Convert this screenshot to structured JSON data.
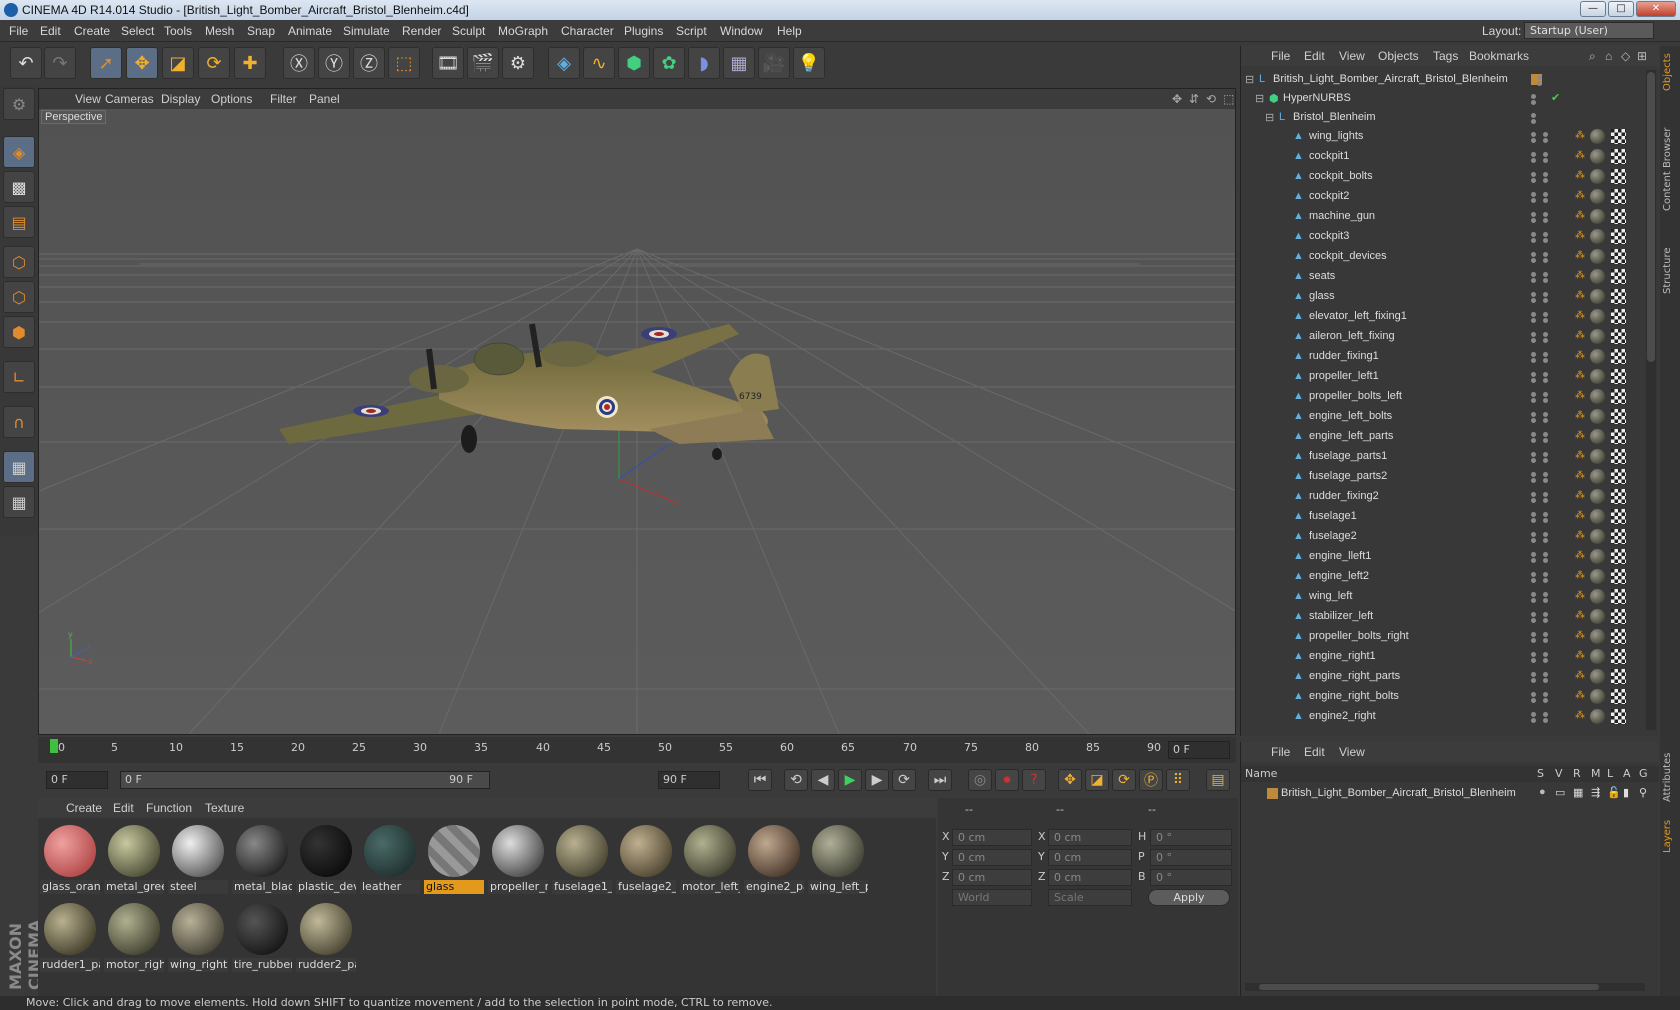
{
  "window": {
    "title": "CINEMA 4D R14.014 Studio - [British_Light_Bomber_Aircraft_Bristol_Blenheim.c4d]",
    "min": "—",
    "max": "□",
    "close": "✕"
  },
  "menu": [
    "File",
    "Edit",
    "Create",
    "Select",
    "Tools",
    "Mesh",
    "Snap",
    "Animate",
    "Simulate",
    "Render",
    "Sculpt",
    "MoGraph",
    "Character",
    "Plugins",
    "Script",
    "Window",
    "Help"
  ],
  "layout": {
    "label": "Layout:",
    "value": "Startup (User)"
  },
  "viewport": {
    "menu": [
      "View",
      "Cameras",
      "Display",
      "Options",
      "Filter",
      "Panel"
    ],
    "label": "Perspective"
  },
  "timeline": {
    "ticks": [
      "0",
      "5",
      "10",
      "15",
      "20",
      "25",
      "30",
      "35",
      "40",
      "45",
      "50",
      "55",
      "60",
      "65",
      "70",
      "75",
      "80",
      "85",
      "90"
    ],
    "current": "0 F"
  },
  "transport": {
    "start": "0 F",
    "range_start": "0 F",
    "range_end": "90 F",
    "end": "90 F"
  },
  "materials": {
    "menu": [
      "Create",
      "Edit",
      "Function",
      "Texture"
    ],
    "items": [
      "glass_oran",
      "metal_gree",
      "steel",
      "metal_blac",
      "plastic_dev",
      "leather",
      "glass",
      "propeller_r",
      "fuselage1_",
      "fuselage2_",
      "motor_left_",
      "engine2_pa",
      "wing_left_p",
      "rudder1_pa",
      "motor_righ",
      "wing_right",
      "tire_rubber",
      "rudder2_pa"
    ],
    "selected": "glass"
  },
  "coords": {
    "header": [
      "--",
      "--",
      "--"
    ],
    "rows": [
      [
        "X",
        "0 cm",
        "X",
        "0 cm",
        "H",
        "0 °"
      ],
      [
        "Y",
        "0 cm",
        "Y",
        "0 cm",
        "P",
        "0 °"
      ],
      [
        "Z",
        "0 cm",
        "Z",
        "0 cm",
        "B",
        "0 °"
      ]
    ],
    "world": "World",
    "scale": "Scale",
    "apply": "Apply"
  },
  "objects": {
    "menu": [
      "File",
      "Edit",
      "View",
      "Objects",
      "Tags",
      "Bookmarks"
    ],
    "root": "British_Light_Bomber_Aircraft_Bristol_Blenheim",
    "nurbs": "HyperNURBS",
    "group": "Bristol_Blenheim",
    "items": [
      "wing_lights",
      "cockpit1",
      "cockpit_bolts",
      "cockpit2",
      "machine_gun",
      "cockpit3",
      "cockpit_devices",
      "seats",
      "glass",
      "elevator_left_fixing1",
      "aileron_left_fixing",
      "rudder_fixing1",
      "propeller_left1",
      "propeller_bolts_left",
      "engine_left_bolts",
      "engine_left_parts",
      "fuselage_parts1",
      "fuselage_parts2",
      "rudder_fixing2",
      "fuselage1",
      "fuselage2",
      "engine_lleft1",
      "engine_left2",
      "wing_left",
      "stabilizer_left",
      "propeller_bolts_right",
      "engine_right1",
      "engine_right_parts",
      "engine_right_bolts",
      "engine2_right"
    ]
  },
  "layers": {
    "menu": [
      "File",
      "Edit",
      "View"
    ],
    "header": [
      "Name",
      "S",
      "V",
      "R",
      "M",
      "L",
      "A",
      "G"
    ],
    "row": "British_Light_Bomber_Aircraft_Bristol_Blenheim"
  },
  "sidetabs": [
    "Objects",
    "Content Browser",
    "Structure",
    "Attributes",
    "Layers"
  ],
  "status": "Move: Click and drag to move elements. Hold down SHIFT to quantize movement / add to the selection in point mode, CTRL to remove.",
  "brand": "MAXON CINEMA 4D"
}
